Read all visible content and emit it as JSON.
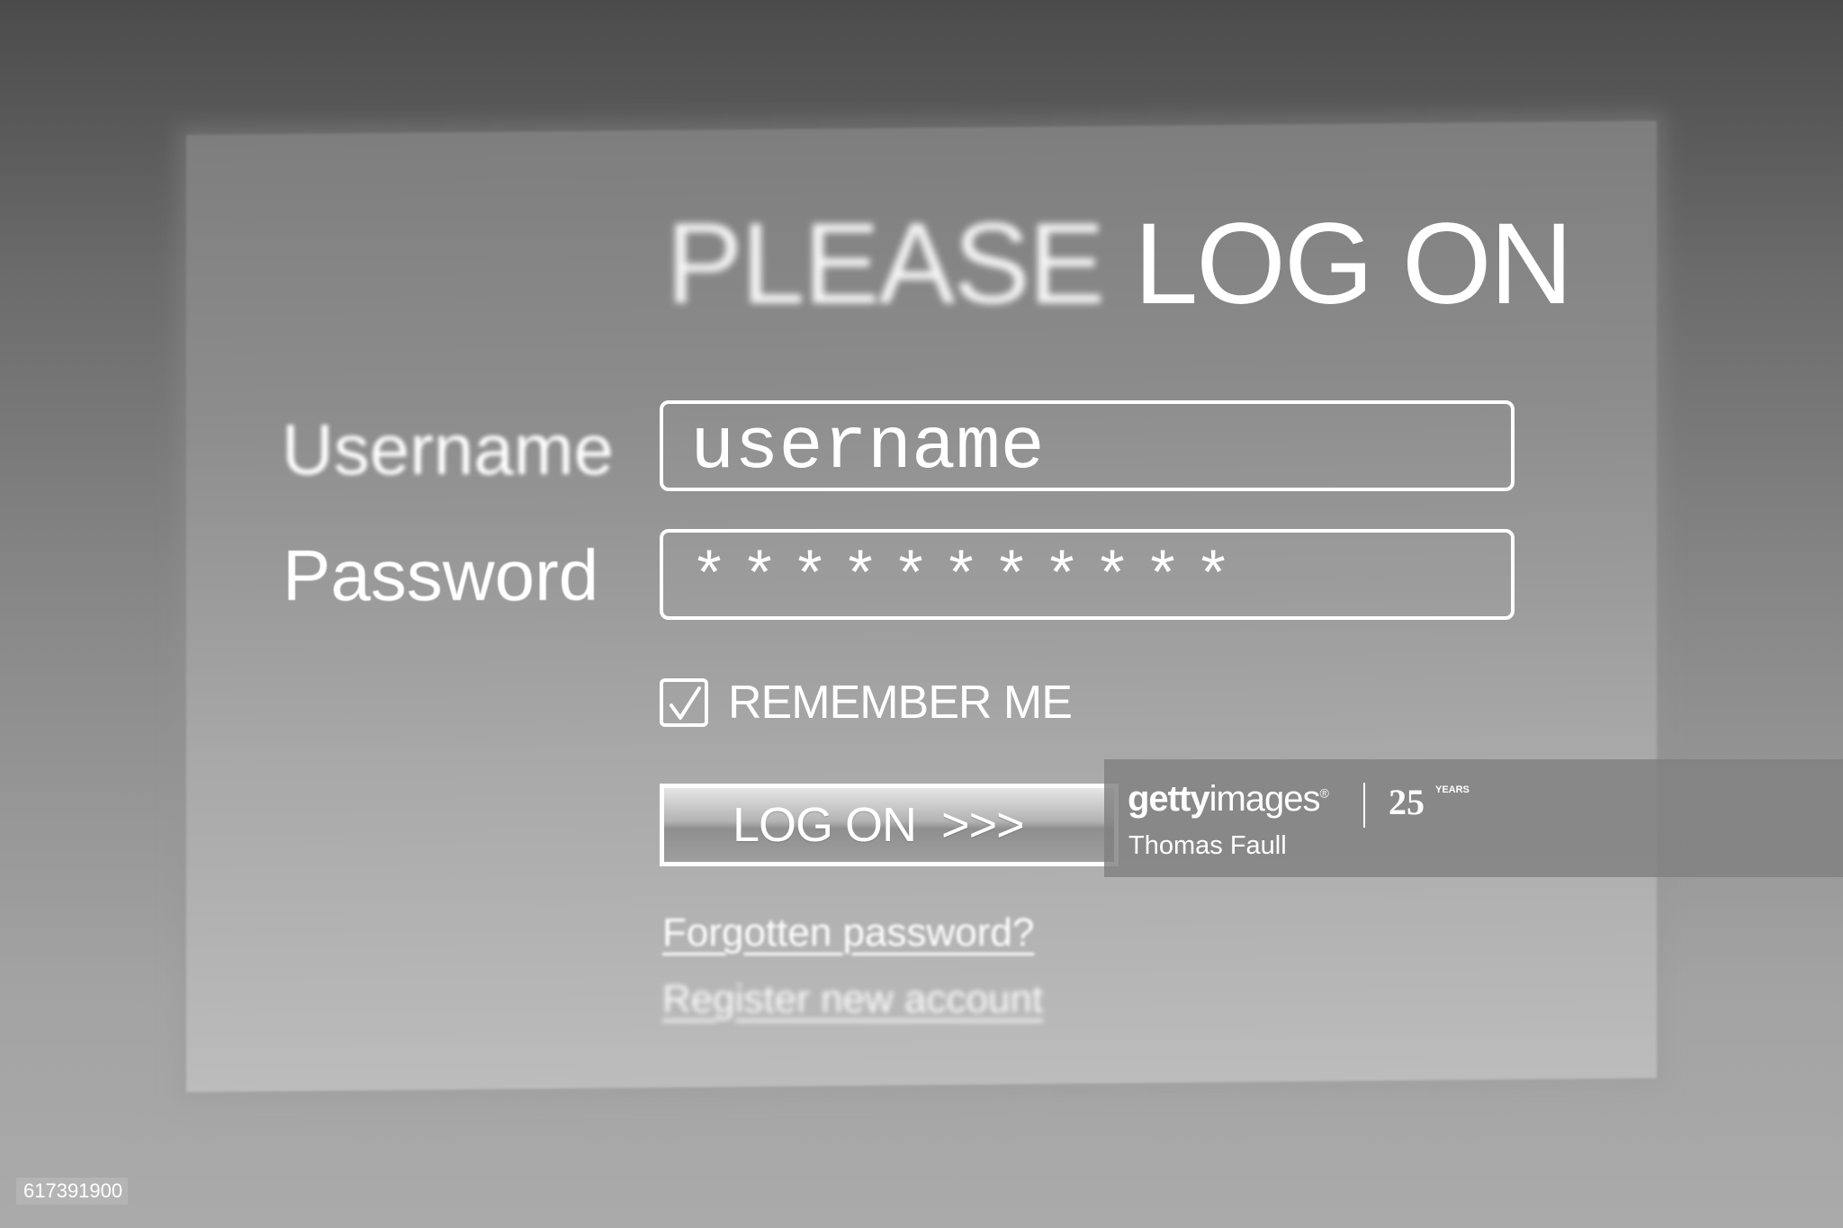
{
  "login": {
    "title_word1": "PLEASE",
    "title_word2": "LOG ON",
    "username_label": "Username",
    "username_value": "username",
    "password_label": "Password",
    "password_value": "***********",
    "remember_label": "REMEMBER ME",
    "remember_checked": true,
    "logon_button_label": "LOG ON  >>>",
    "forgot_link": "Forgotten password?",
    "register_link": "Register new account"
  },
  "watermark": {
    "brand_bold": "getty",
    "brand_regular": "images",
    "registered_mark": "®",
    "anniversary": "25",
    "anniversary_suffix": "YEARS",
    "author": "Thomas Faull",
    "image_id": "617391900"
  },
  "colors": {
    "text": "#ffffff",
    "background_top": "#4b4b4b",
    "background_bottom": "#aaaaaa"
  }
}
